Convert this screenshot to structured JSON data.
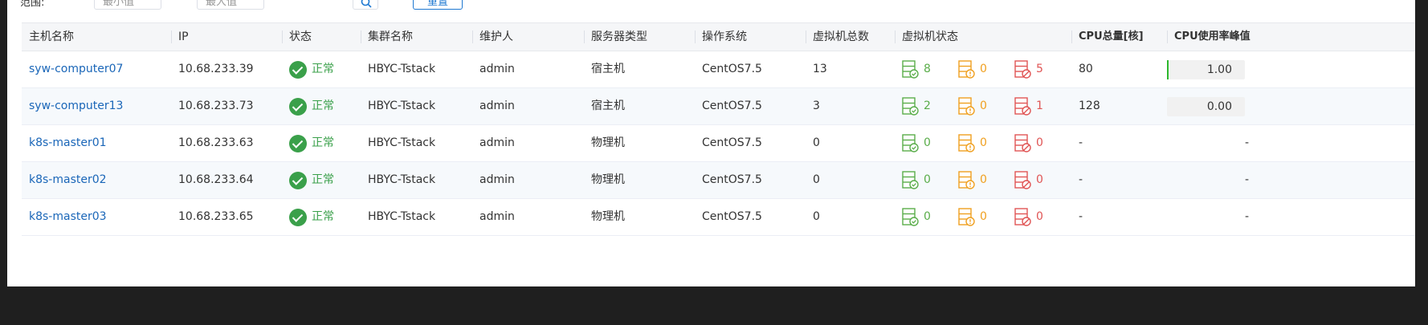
{
  "filters": {
    "label": "范围:",
    "start_value": "最小值",
    "dash": "—",
    "end_value": "最大值",
    "reset_label": "重置"
  },
  "table": {
    "headers": [
      "主机名称",
      "IP",
      "状态",
      "集群名称",
      "维护人",
      "服务器类型",
      "操作系统",
      "虚拟机总数",
      "虚拟机状态",
      "CPU总量[核]",
      "CPU使用率峰值"
    ],
    "rows": [
      {
        "host": "syw-computer07",
        "ip": "10.68.233.39",
        "status": "正常",
        "cluster": "HBYC-Tstack",
        "owner": "admin",
        "server_type": "宿主机",
        "os": "CentOS7.5",
        "vm_total": "13",
        "vm_running": "8",
        "vm_warning": "0",
        "vm_stopped": "5",
        "cpu_total": "80",
        "cpu_peak": "1.00",
        "cpu_fill": 0.02
      },
      {
        "host": "syw-computer13",
        "ip": "10.68.233.73",
        "status": "正常",
        "cluster": "HBYC-Tstack",
        "owner": "admin",
        "server_type": "宿主机",
        "os": "CentOS7.5",
        "vm_total": "3",
        "vm_running": "2",
        "vm_warning": "0",
        "vm_stopped": "1",
        "cpu_total": "128",
        "cpu_peak": "0.00",
        "cpu_fill": 0
      },
      {
        "host": "k8s-master01",
        "ip": "10.68.233.63",
        "status": "正常",
        "cluster": "HBYC-Tstack",
        "owner": "admin",
        "server_type": "物理机",
        "os": "CentOS7.5",
        "vm_total": "0",
        "vm_running": "0",
        "vm_warning": "0",
        "vm_stopped": "0",
        "cpu_total": "-",
        "cpu_peak": "-",
        "cpu_fill": null
      },
      {
        "host": "k8s-master02",
        "ip": "10.68.233.64",
        "status": "正常",
        "cluster": "HBYC-Tstack",
        "owner": "admin",
        "server_type": "物理机",
        "os": "CentOS7.5",
        "vm_total": "0",
        "vm_running": "0",
        "vm_warning": "0",
        "vm_stopped": "0",
        "cpu_total": "-",
        "cpu_peak": "-",
        "cpu_fill": null
      },
      {
        "host": "k8s-master03",
        "ip": "10.68.233.65",
        "status": "正常",
        "cluster": "HBYC-Tstack",
        "owner": "admin",
        "server_type": "物理机",
        "os": "CentOS7.5",
        "vm_total": "0",
        "vm_running": "0",
        "vm_warning": "0",
        "vm_stopped": "0",
        "cpu_total": "-",
        "cpu_peak": "-",
        "cpu_fill": null
      }
    ]
  },
  "icons": {
    "search": "search-icon",
    "status_ok": "check-circle-icon",
    "vm_running": "server-running-icon",
    "vm_warning": "server-warning-icon",
    "vm_stopped": "server-stopped-icon"
  },
  "colors": {
    "link": "#1a66b8",
    "ok": "#3aa04a",
    "running": "#5aad4a",
    "warning": "#f0a020",
    "stopped": "#e05555",
    "accent": "#1e78d1"
  }
}
